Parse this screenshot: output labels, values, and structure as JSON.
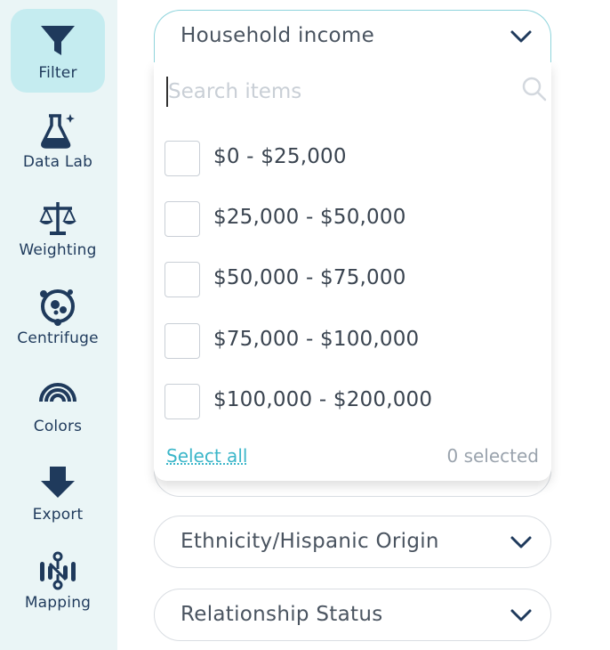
{
  "sidebar": {
    "items": [
      {
        "label": "Filter",
        "icon": "funnel-icon",
        "active": true
      },
      {
        "label": "Data Lab",
        "icon": "flask-icon",
        "active": false
      },
      {
        "label": "Weighting",
        "icon": "scales-icon",
        "active": false
      },
      {
        "label": "Centrifuge",
        "icon": "centrifuge-icon",
        "active": false
      },
      {
        "label": "Colors",
        "icon": "rainbow-icon",
        "active": false
      },
      {
        "label": "Export",
        "icon": "download-arrow-icon",
        "active": false
      },
      {
        "label": "Mapping",
        "icon": "mapping-icon",
        "active": false
      }
    ]
  },
  "filters": {
    "open": {
      "label": "Household income",
      "search_placeholder": "Search items",
      "options": [
        "$0 - $25,000",
        "$25,000 - $50,000",
        "$50,000 - $75,000",
        "$75,000 - $100,000",
        "$100,000 - $200,000"
      ],
      "select_all": "Select all",
      "selected_count": "0 selected"
    },
    "closed": [
      {
        "label": "Ethnicity/Hispanic Origin"
      },
      {
        "label": "Relationship Status"
      }
    ]
  },
  "colors": {
    "sidebar_bg": "#eaf5f6",
    "active_bg": "#c5ecf0",
    "accent": "#3bb6c9",
    "icon": "#1f3a5c"
  }
}
